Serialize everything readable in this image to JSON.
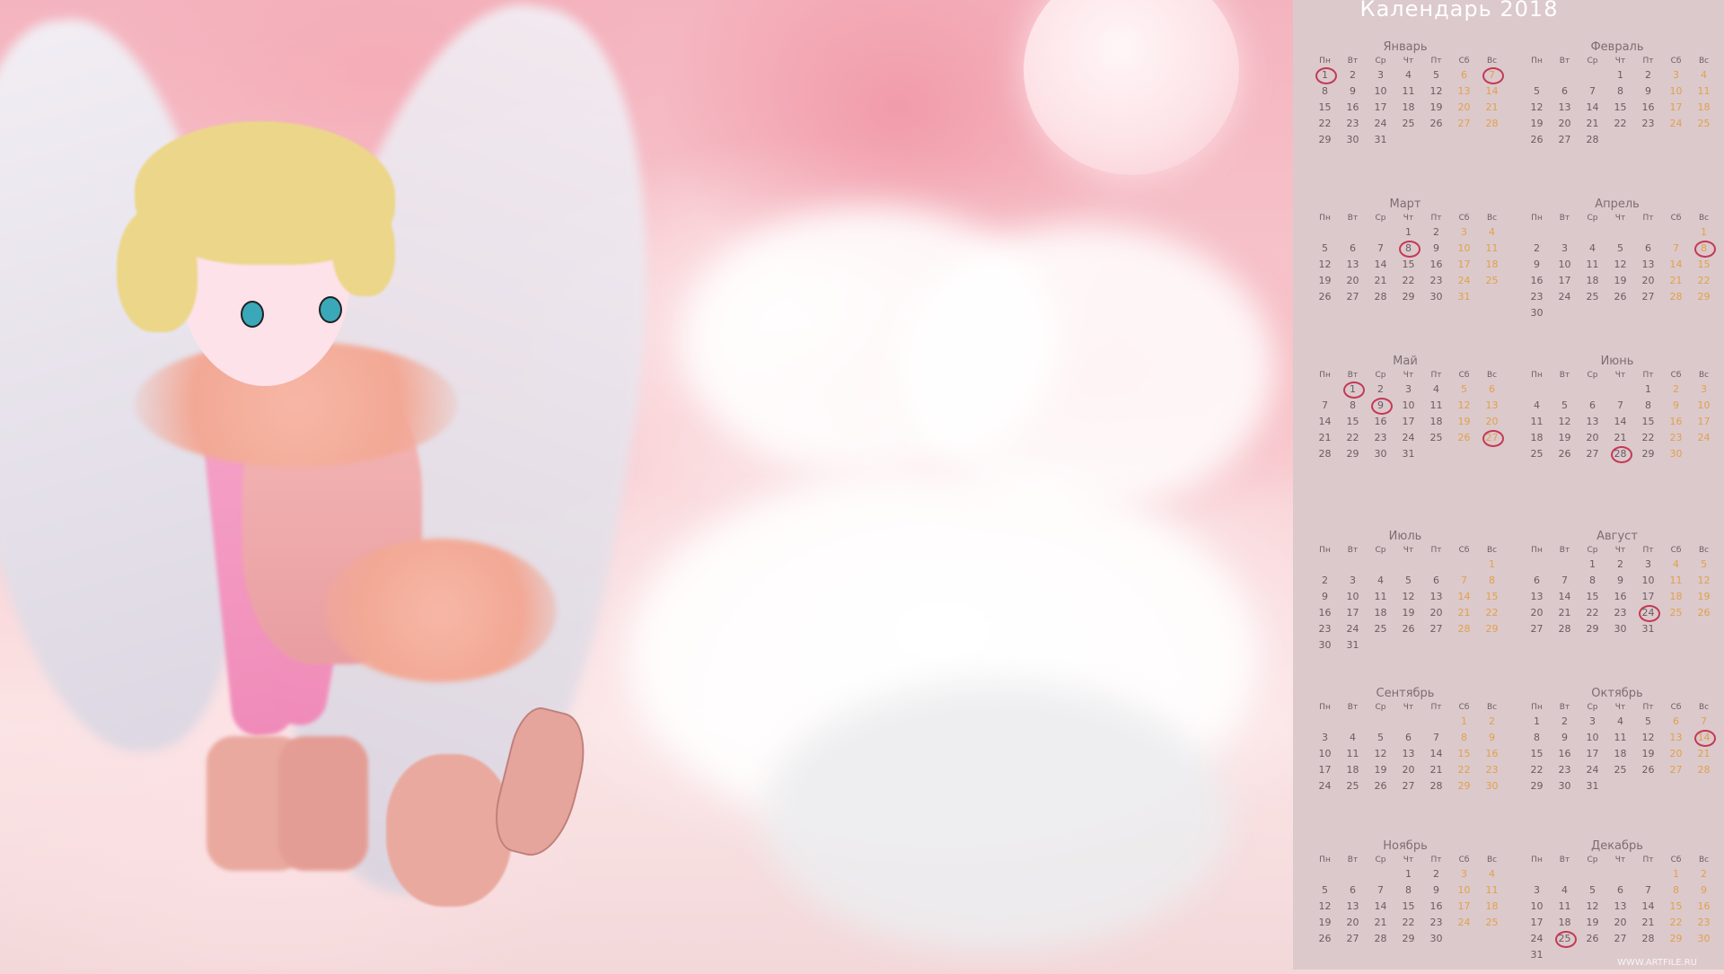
{
  "title": "Календарь 2018",
  "watermark": "WWW.ARTFILE.RU",
  "weekdays": [
    "Пн",
    "Вт",
    "Ср",
    "Чт",
    "Пт",
    "Сб",
    "Вс"
  ],
  "colors": {
    "panel_bg": "#dcc9cc",
    "weekend": "#e0a14a",
    "weekday": "#6a5c60",
    "circle": "#c23a55"
  },
  "months": [
    {
      "name": "Январь",
      "start": 0,
      "days": 31,
      "circled": [
        1,
        7
      ]
    },
    {
      "name": "Февраль",
      "start": 3,
      "days": 28,
      "circled": []
    },
    {
      "name": "Март",
      "start": 3,
      "days": 31,
      "circled": [
        8
      ]
    },
    {
      "name": "Апрель",
      "start": 6,
      "days": 30,
      "circled": [
        8
      ]
    },
    {
      "name": "Май",
      "start": 1,
      "days": 31,
      "circled": [
        1,
        9,
        27
      ]
    },
    {
      "name": "Июнь",
      "start": 4,
      "days": 30,
      "circled": [
        28
      ]
    },
    {
      "name": "Июль",
      "start": 6,
      "days": 31,
      "circled": []
    },
    {
      "name": "Август",
      "start": 2,
      "days": 31,
      "circled": [
        24
      ]
    },
    {
      "name": "Сентябрь",
      "start": 5,
      "days": 30,
      "circled": []
    },
    {
      "name": "Октябрь",
      "start": 0,
      "days": 31,
      "circled": [
        14
      ]
    },
    {
      "name": "Ноябрь",
      "start": 3,
      "days": 30,
      "circled": []
    },
    {
      "name": "Декабрь",
      "start": 5,
      "days": 31,
      "circled": [
        25
      ]
    }
  ]
}
